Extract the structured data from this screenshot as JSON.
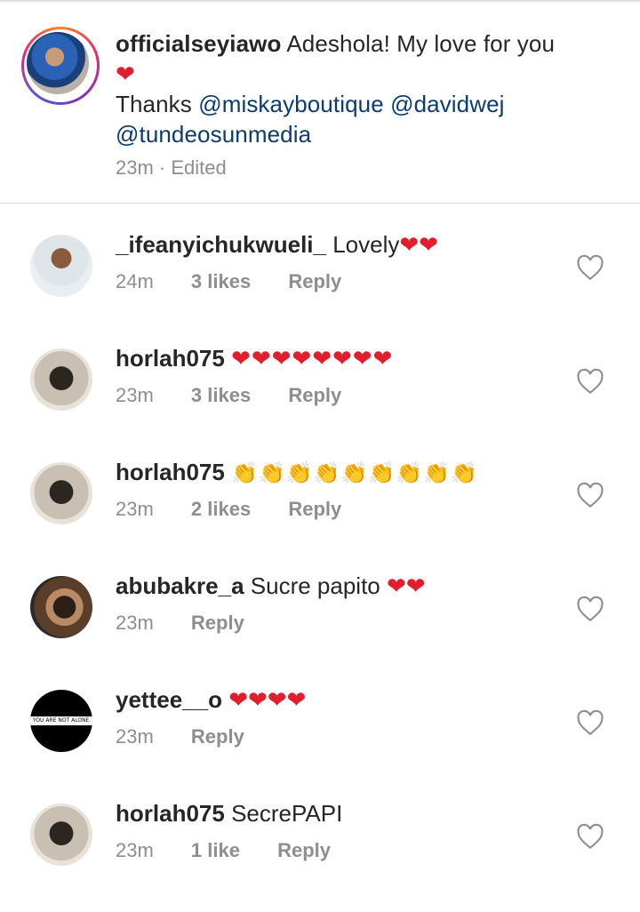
{
  "caption": {
    "username": "officialseyiawo",
    "text": "Adeshola! My love for you",
    "thanks_prefix": "Thanks",
    "mentions": [
      "@miskayboutique",
      "@davidwej",
      "@tundeosunmedia"
    ],
    "time": "23m",
    "edited": "Edited"
  },
  "comments": [
    {
      "username": "_ifeanyichukwueli_",
      "text": "Lovely",
      "emoji": "❤❤",
      "time": "24m",
      "likes": "3 likes",
      "reply": "Reply"
    },
    {
      "username": "horlah075",
      "text": "",
      "emoji": "❤❤❤❤❤❤❤❤",
      "time": "23m",
      "likes": "3 likes",
      "reply": "Reply"
    },
    {
      "username": "horlah075",
      "text": "",
      "emoji": "👏👏👏👏👏👏👏👏👏",
      "time": "23m",
      "likes": "2 likes",
      "reply": "Reply"
    },
    {
      "username": "abubakre_a",
      "text": "Sucre papito",
      "emoji": "❤❤",
      "time": "23m",
      "likes": "",
      "reply": "Reply"
    },
    {
      "username": "yettee__o",
      "text": "",
      "emoji": "❤❤❤❤",
      "time": "23m",
      "likes": "",
      "reply": "Reply"
    },
    {
      "username": "horlah075",
      "text": "SecrePAPI",
      "emoji": "",
      "time": "23m",
      "likes": "1 like",
      "reply": "Reply"
    }
  ],
  "avatar_text": {
    "yettee": "YOU ARE NOT ALONE."
  },
  "colors": {
    "heart": "#e01e2e",
    "mention": "#0b3c6e",
    "meta": "#8e8e8e"
  },
  "icons": {
    "like": "heart-outline-icon"
  }
}
